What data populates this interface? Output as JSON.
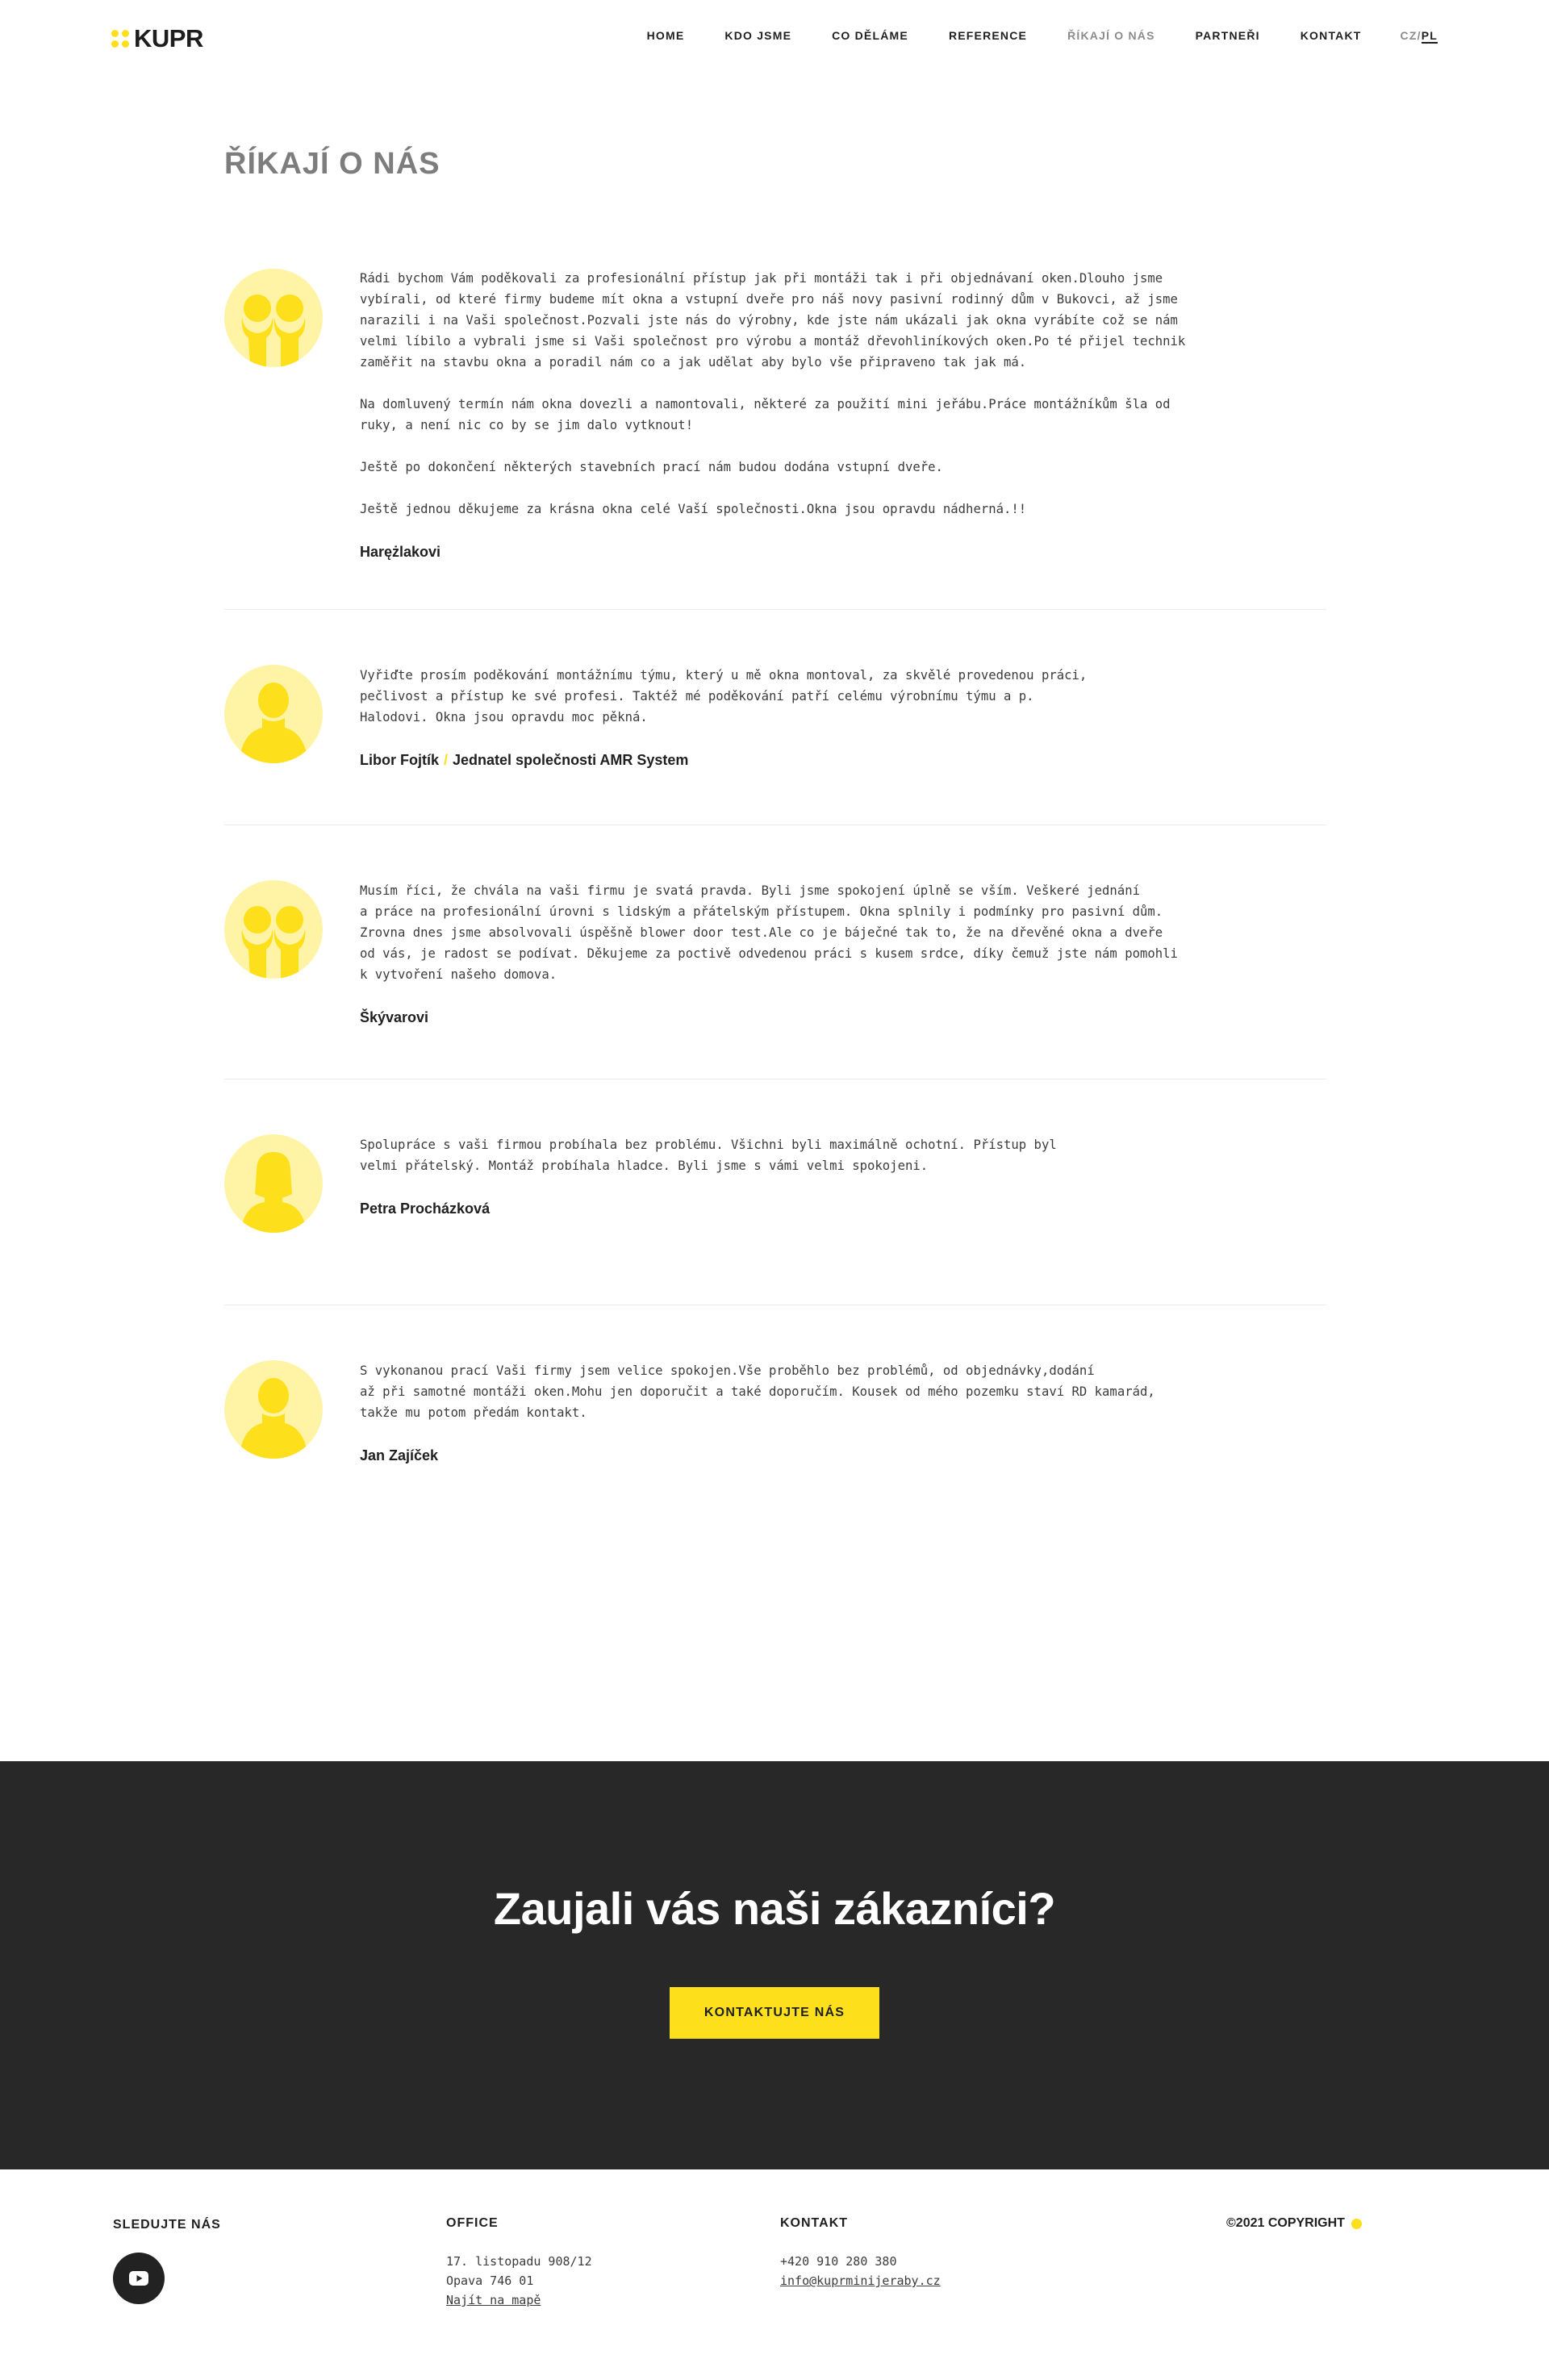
{
  "header": {
    "logo_text": "KUPR",
    "nav": [
      "HOME",
      "KDO JSME",
      "CO DĚLÁME",
      "REFERENCE",
      "ŘÍKAJÍ O NÁS",
      "PARTNEŘI",
      "KONTAKT"
    ],
    "active_nav": "ŘÍKAJÍ O NÁS",
    "lang_cz": "CZ",
    "lang_sep": "/",
    "lang_pl": "PL"
  },
  "page_title": "ŘÍKAJÍ O NÁS",
  "testimonials": [
    {
      "avatar": "couple-icon",
      "text": "Rádi bychom Vám poděkovali za profesionální přístup jak při montáži tak i při objednávaní oken.Dlouho jsme\nvybírali, od které firmy budeme mít okna a vstupní dveře pro náš novy pasivní rodinný dům v Bukovci, až jsme\nnarazili i na Vaši společnost.Pozvali jste nás do výrobny, kde jste nám ukázali jak okna vyrábíte což se nám\nvelmi líbilo a vybrali jsme si Vaši společnost pro výrobu a montáž dřevohliníkových oken.Po té přijel technik\nzaměřit na stavbu okna a poradil nám co a jak udělat aby bylo vše připraveno tak jak má.\n\nNa domluvený termín nám okna dovezli a namontovali, některé za použití mini jeřábu.Práce montážníkům šla od\nruky, a není nic co by se jim dalo vytknout!\n\nJeště po dokončení některých stavebních prací nám budou dodána vstupní dveře.\n\nJeště jednou děkujeme za krásna okna celé Vaší společnosti.Okna jsou opravdu nádherná.!!",
      "author": "Harężlakovi",
      "role": ""
    },
    {
      "avatar": "man-icon",
      "text": "Vyřiďte prosím poděkování montážnímu týmu, který u mě okna montoval, za skvělé provedenou práci,\npečlivost a přístup ke své profesi. Taktéž mé poděkování patří celému výrobnímu týmu a p.\nHalodovi. Okna jsou opravdu moc pěkná.",
      "author": "Libor Fojtík",
      "role": "Jednatel společnosti AMR System"
    },
    {
      "avatar": "couple-icon",
      "text": "Musím říci, že chvála na vaši firmu je svatá pravda. Byli jsme spokojení úplně se vším. Veškeré jednání\na práce na profesionální úrovni s lidským a přátelským přístupem. Okna splnily i podmínky pro pasivní dům.\nZrovna dnes jsme absolvovali úspěšně blower door test.Ale co je báječné tak to, že na dřevěné okna a dveře\nod vás, je radost se podívat. Děkujeme za poctivě odvedenou práci s kusem srdce, díky čemuž jste nám pomohli\nk vytvoření našeho domova.",
      "author": "Škývarovi",
      "role": ""
    },
    {
      "avatar": "woman-icon",
      "text": "Spolupráce s vaši firmou probíhala bez problému. Všichni byli maximálně ochotní. Přístup byl\nvelmi přátelský. Montáž probíhala hladce. Byli jsme s vámi velmi spokojeni.",
      "author": "Petra Procházková",
      "role": ""
    },
    {
      "avatar": "man-icon",
      "text": "S vykonanou prací Vaši firmy jsem velice spokojen.Vše proběhlo bez problémů, od objednávky,dodání\naž při samotné montáži oken.Mohu jen doporučit a také doporučím. Kousek od mého pozemku staví RD kamarád,\ntakže mu potom předám kontakt.",
      "author": "Jan Zajíček",
      "role": ""
    }
  ],
  "cta": {
    "title": "Zaujali vás naši zákazníci?",
    "button": "KONTAKTUJTE NÁS"
  },
  "footer": {
    "follow_heading": "SLEDUJTE NÁS",
    "social_icon": "youtube-icon",
    "office_heading": "OFFICE",
    "office_line1": "17. listopadu 908/12",
    "office_line2": "Opava 746 01",
    "office_map_link": "Najít na mapě",
    "contact_heading": "KONTAKT",
    "phone": "+420 910 280 380",
    "email": "info@kuprminijeraby.cz",
    "copyright": "©2021 COPYRIGHT"
  },
  "colors": {
    "accent": "#fddf1b",
    "avatar_bg": "#fff4a6",
    "cta_bg": "#282828",
    "title_grey": "#7d7d7d"
  }
}
